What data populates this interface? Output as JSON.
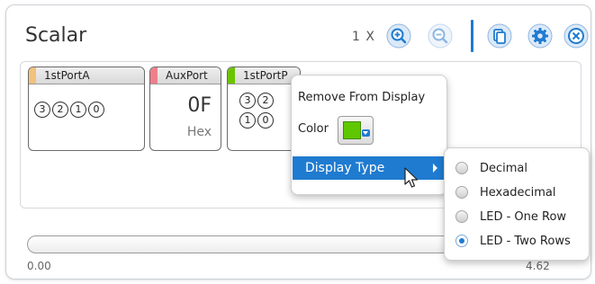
{
  "window": {
    "title": "Scalar"
  },
  "toolbar": {
    "zoom_label": "1 X",
    "buttons": [
      "zoom-in-icon",
      "zoom-out-icon",
      "copy-icon",
      "settings-icon",
      "close-icon"
    ],
    "accent_color": "#1f7bd0"
  },
  "ports": [
    {
      "name": "1stPortA",
      "color": "#f1c27d",
      "leds": [
        "3",
        "2",
        "1",
        "0"
      ]
    },
    {
      "name": "AuxPort",
      "color": "#ef7f8c",
      "value": "0F",
      "format": "Hex"
    },
    {
      "name": "1stPortP",
      "color": "#6cc300",
      "leds_top": [
        "3",
        "2"
      ],
      "leds_bottom": [
        "1",
        "0"
      ]
    }
  ],
  "context_menu": {
    "remove": "Remove From Display",
    "color_label": "Color",
    "color_value": "#5fc700",
    "display_type": "Display Type"
  },
  "display_type_menu": {
    "options": [
      {
        "label": "Decimal",
        "selected": false
      },
      {
        "label": "Hexadecimal",
        "selected": false
      },
      {
        "label": "LED - One Row",
        "selected": false
      },
      {
        "label": "LED - Two Rows",
        "selected": true
      }
    ]
  },
  "slider": {
    "min": "0.00",
    "max": "4.62"
  }
}
